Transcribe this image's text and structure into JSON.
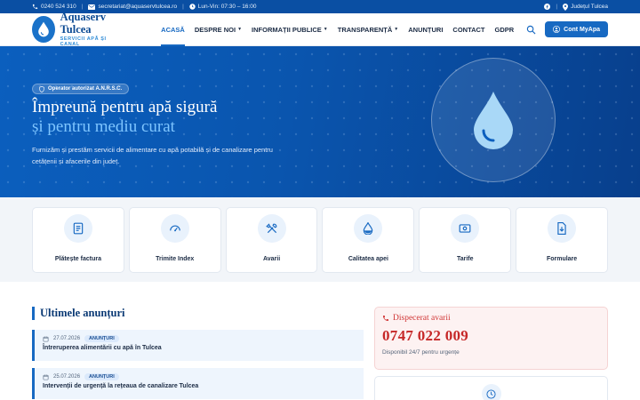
{
  "topbar": {
    "phone": "0240 524 310",
    "email": "secretariat@aquaservtulcea.ro",
    "hours": "Lun-Vin: 07:30 – 16:00",
    "region": "Județul Tulcea"
  },
  "brand": {
    "name": "Aquaserv Tulcea",
    "tagline": "SERVICII APĂ ȘI CANAL"
  },
  "nav": {
    "items": [
      {
        "label": "ACASĂ",
        "active": true,
        "has_dropdown": false
      },
      {
        "label": "DESPRE NOI",
        "active": false,
        "has_dropdown": true
      },
      {
        "label": "INFORMAȚII PUBLICE",
        "active": false,
        "has_dropdown": true
      },
      {
        "label": "TRANSPARENȚĂ",
        "active": false,
        "has_dropdown": true
      },
      {
        "label": "ANUNȚURI",
        "active": false,
        "has_dropdown": false
      },
      {
        "label": "CONTACT",
        "active": false,
        "has_dropdown": false
      },
      {
        "label": "GDPR",
        "active": false,
        "has_dropdown": false
      }
    ],
    "account_button": "Cont MyApa"
  },
  "hero": {
    "badge": "Operator autorizat A.N.R.S.C.",
    "title_line1": "Împreună pentru apă sigură",
    "title_line2": "și pentru mediu curat",
    "description": "Furnizăm și prestăm servicii de alimentare cu apă potabilă și de canalizare pentru cetățenii și afacerile din județ."
  },
  "services": [
    {
      "label": "Plătește factura",
      "icon": "invoice-icon"
    },
    {
      "label": "Trimite Index",
      "icon": "gauge-icon"
    },
    {
      "label": "Avarii",
      "icon": "tools-icon"
    },
    {
      "label": "Calitatea apei",
      "icon": "water-drop-icon"
    },
    {
      "label": "Tarife",
      "icon": "money-icon"
    },
    {
      "label": "Formulare",
      "icon": "download-file-icon"
    }
  ],
  "announcements": {
    "title": "Ultimele anunțuri",
    "items": [
      {
        "date": "27.07.2026",
        "tag": "ANUNȚURI",
        "title": "Întreruperea alimentării cu apă în Tulcea"
      },
      {
        "date": "25.07.2026",
        "tag": "ANUNȚURI",
        "title": "Intervenții de urgență la rețeaua de canalizare Tulcea"
      }
    ]
  },
  "dispatch": {
    "title": "Dispecerat avarii",
    "phone": "0747 022 009",
    "subtitle": "Disponibil 24/7 pentru urgențe"
  },
  "colors": {
    "primary": "#1769c2",
    "topbar": "#0a4fa3",
    "hero_accent": "#7ec5ff",
    "alert_red": "#c62828"
  }
}
